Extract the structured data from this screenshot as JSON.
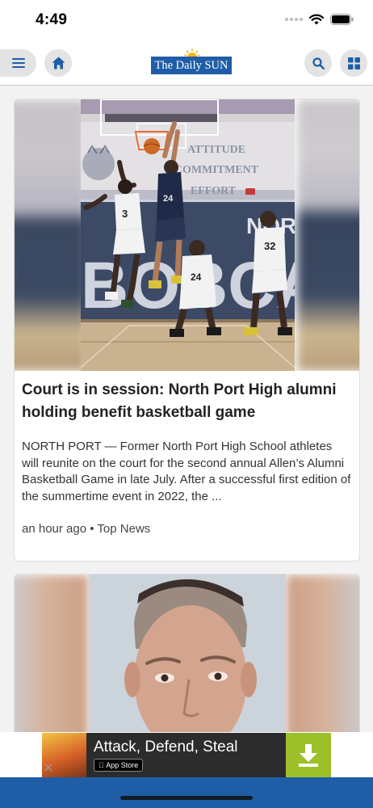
{
  "status_bar": {
    "time": "4:49"
  },
  "header": {
    "logo_text": "The Daily SUN",
    "menu_icon": "hamburger-menu-icon",
    "home_icon": "home-icon",
    "search_icon": "search-icon",
    "sections_icon": "grid-icon"
  },
  "feed": {
    "articles": [
      {
        "title": "Court is in session: North Port High alumni holding benefit basketball game",
        "summary": "NORTH PORT — Former North Port High School athletes will reunite on the court for the second annual Allen’s Alumni Basketball Game in late July. After a successful first edition of the summertime event in 2022, the ...",
        "time": "an hour ago",
        "separator": "•",
        "section": "Top News",
        "image_wall_text": [
          "ATTITUDE",
          "COMMITMENT",
          "EFFORT",
          "NORTH PORT",
          "BOBCAT"
        ],
        "jersey_numbers": [
          "3",
          "24",
          "24",
          "32"
        ]
      },
      {
        "image": "mugshot-photo"
      }
    ]
  },
  "ad": {
    "title": "Attack, Defend, Steal",
    "store_badge": "App Store",
    "download_icon": "download-icon"
  },
  "colors": {
    "brand_blue": "#1f5ea6",
    "ad_green": "#9cbf2a"
  }
}
